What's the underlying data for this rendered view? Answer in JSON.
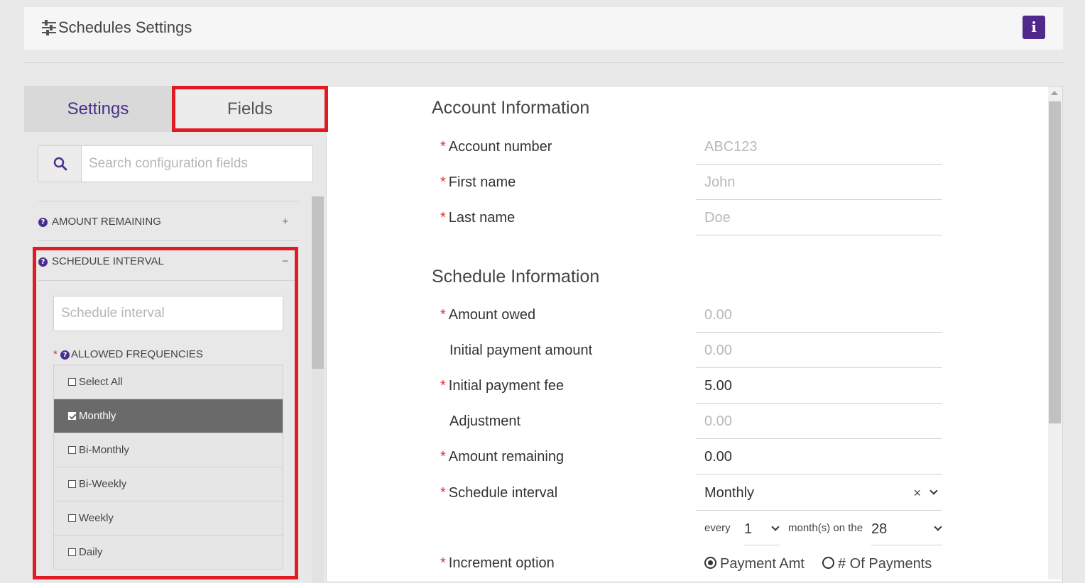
{
  "header": {
    "title": "Schedules Settings",
    "info_label": "i"
  },
  "tabs": {
    "settings": "Settings",
    "fields": "Fields"
  },
  "search": {
    "placeholder": "Search configuration fields"
  },
  "sections": {
    "amount_remaining": {
      "label": "AMOUNT REMAINING",
      "toggle": "+"
    },
    "schedule_interval": {
      "label": "SCHEDULE INTERVAL",
      "toggle": "−",
      "input_placeholder": "Schedule interval",
      "freq_label": "ALLOWED FREQUENCIES",
      "freq_required": "*",
      "frequencies": [
        {
          "label": "Select All",
          "checked": false
        },
        {
          "label": "Monthly",
          "checked": true
        },
        {
          "label": "Bi-Monthly",
          "checked": false
        },
        {
          "label": "Bi-Weekly",
          "checked": false
        },
        {
          "label": "Weekly",
          "checked": false
        },
        {
          "label": "Daily",
          "checked": false
        }
      ]
    }
  },
  "account": {
    "title": "Account Information",
    "fields": [
      {
        "label": "Account number",
        "required": "*",
        "value": "ABC123"
      },
      {
        "label": "First name",
        "required": "*",
        "value": "John"
      },
      {
        "label": "Last name",
        "required": "*",
        "value": "Doe"
      }
    ]
  },
  "schedule": {
    "title": "Schedule Information",
    "fields": [
      {
        "label": "Amount owed",
        "required": "*",
        "value": "0.00"
      },
      {
        "label": "Initial payment amount",
        "required": "",
        "value": "0.00"
      },
      {
        "label": "Initial payment fee",
        "required": "*",
        "value": "5.00"
      },
      {
        "label": "Adjustment",
        "required": "",
        "value": "0.00"
      },
      {
        "label": "Amount remaining",
        "required": "*",
        "value": "0.00"
      },
      {
        "label": "Schedule interval",
        "required": "*",
        "value": "Monthly"
      },
      {
        "label": "Increment option",
        "required": "*",
        "value": ""
      }
    ],
    "interval_clear": "×",
    "every_label": "every",
    "every_value": "1",
    "months_label": "month(s) on the",
    "day_value": "28",
    "increment_options": [
      "Payment Amt",
      "# Of Payments"
    ]
  }
}
